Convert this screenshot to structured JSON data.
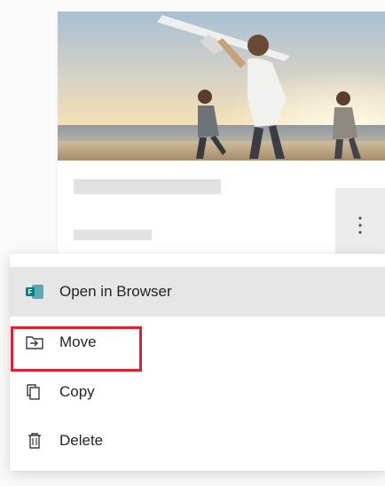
{
  "menu": {
    "items": [
      {
        "label": "Open in Browser",
        "icon": "teams-forms-icon"
      },
      {
        "label": "Move",
        "icon": "move-folder-icon"
      },
      {
        "label": "Copy",
        "icon": "copy-icon"
      },
      {
        "label": "Delete",
        "icon": "trash-icon"
      }
    ]
  },
  "card": {
    "more_button_icon": "vertical-ellipsis-icon",
    "thumbnail": "beach-kids-toy-airplane-photo"
  },
  "highlight": {
    "color": "#e0202c",
    "target": "Move"
  },
  "colors": {
    "menu_hover": "#e6e6e6",
    "skeleton": "#e2e2e2",
    "brand_teal": "#038387"
  }
}
